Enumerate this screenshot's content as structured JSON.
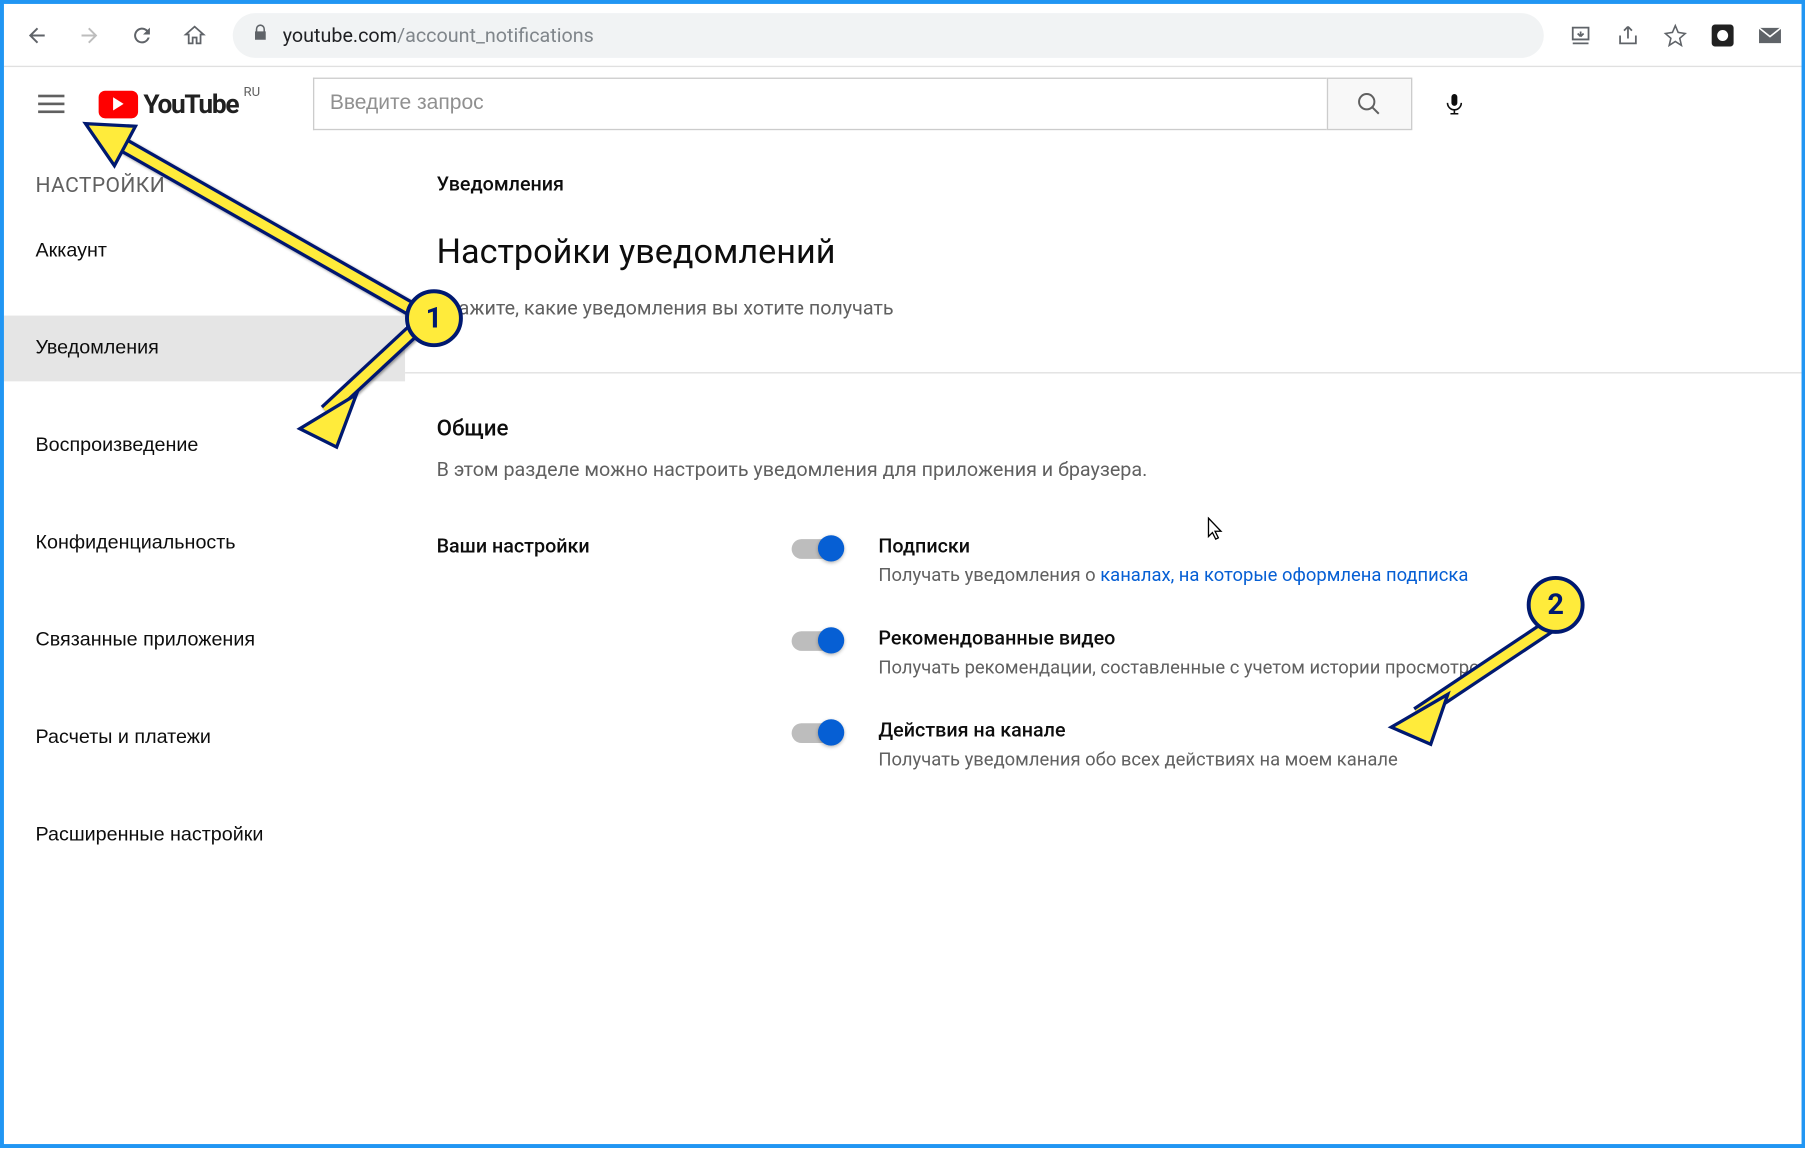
{
  "browser": {
    "url_domain": "youtube.com",
    "url_path": "/account_notifications"
  },
  "header": {
    "logo_text": "YouTube",
    "region": "RU",
    "search_placeholder": "Введите запрос"
  },
  "sidebar": {
    "title": "НАСТРОЙКИ",
    "items": [
      {
        "label": "Аккаунт"
      },
      {
        "label": "Уведомления",
        "active": true
      },
      {
        "label": "Воспроизведение"
      },
      {
        "label": "Конфиденциальность"
      },
      {
        "label": "Связанные приложения"
      },
      {
        "label": "Расчеты и платежи"
      },
      {
        "label": "Расширенные настройки"
      }
    ]
  },
  "content": {
    "section_label": "Уведомления",
    "title": "Настройки уведомлений",
    "subtitle": "Укажите, какие уведомления вы хотите получать",
    "general_title": "Общие",
    "general_desc": "В этом разделе можно настроить уведомления для приложения и браузера.",
    "prefs_label": "Ваши настройки",
    "toggles": [
      {
        "title": "Подписки",
        "desc_prefix": "Получать уведомления о ",
        "desc_link": "каналах, на которые оформлена подписка",
        "on": true
      },
      {
        "title": "Рекомендованные видео",
        "desc": "Получать рекомендации, составленные с учетом истории просмотров",
        "on": true
      },
      {
        "title": "Действия на канале",
        "desc": "Получать уведомления обо всех действиях на моем канале",
        "on": true
      }
    ]
  },
  "annotations": {
    "num1": "1",
    "num2": "2"
  }
}
